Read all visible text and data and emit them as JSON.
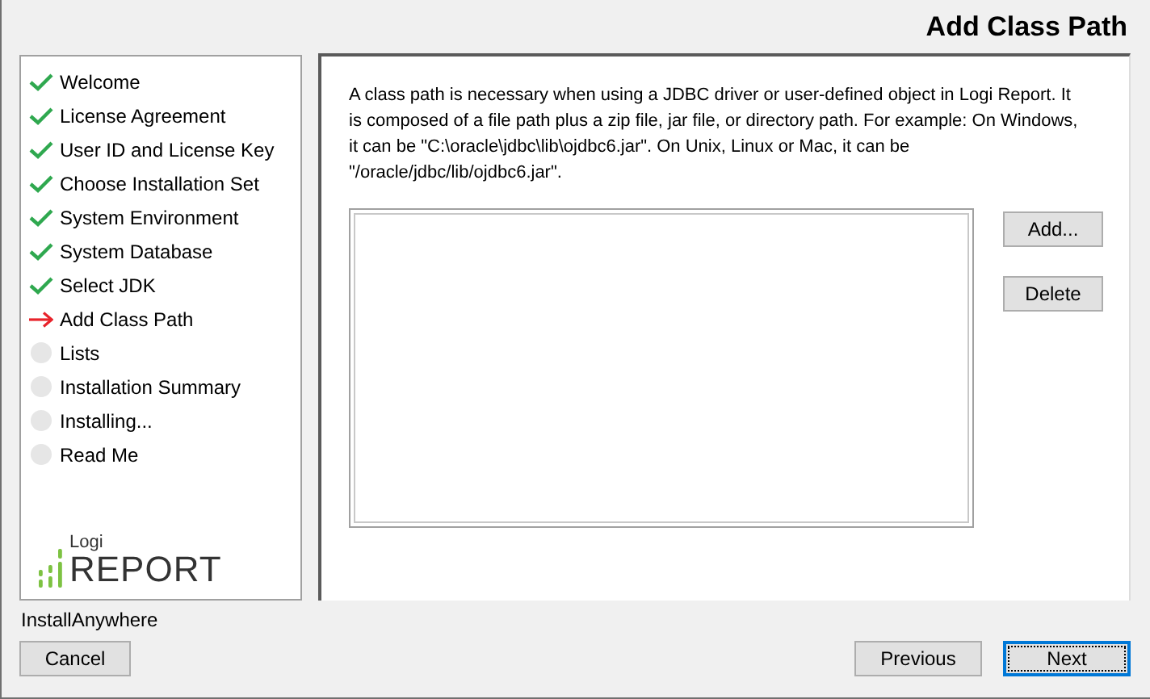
{
  "header": {
    "title": "Add Class Path"
  },
  "steps": [
    {
      "label": "Welcome",
      "kind": "done"
    },
    {
      "label": "License Agreement",
      "kind": "done"
    },
    {
      "label": "User ID and License Key",
      "kind": "done"
    },
    {
      "label": "Choose Installation Set",
      "kind": "done"
    },
    {
      "label": "System Environment",
      "kind": "done"
    },
    {
      "label": "System Database",
      "kind": "done"
    },
    {
      "label": "Select JDK",
      "kind": "done"
    },
    {
      "label": "Add Class Path",
      "kind": "current"
    },
    {
      "label": "Lists",
      "kind": "pending"
    },
    {
      "label": "Installation Summary",
      "kind": "pending"
    },
    {
      "label": "Installing...",
      "kind": "pending"
    },
    {
      "label": "Read Me",
      "kind": "pending"
    }
  ],
  "logo": {
    "small": "Logi",
    "large": "REPORT"
  },
  "content": {
    "description": "A class path is necessary when using a JDBC driver or user-defined object in Logi Report. It is composed of a file path plus a zip file, jar file, or directory path. For example: On Windows, it can be \"C:\\oracle\\jdbc\\lib\\ojdbc6.jar\". On Unix, Linux or Mac, it can be \"/oracle/jdbc/lib/ojdbc6.jar\".",
    "side_buttons": [
      {
        "label": "Add..."
      },
      {
        "label": "Delete"
      }
    ]
  },
  "footer": {
    "vendor": "InstallAnywhere",
    "cancel": "Cancel",
    "previous": "Previous",
    "next": {
      "label": "Next",
      "focused": true
    }
  }
}
